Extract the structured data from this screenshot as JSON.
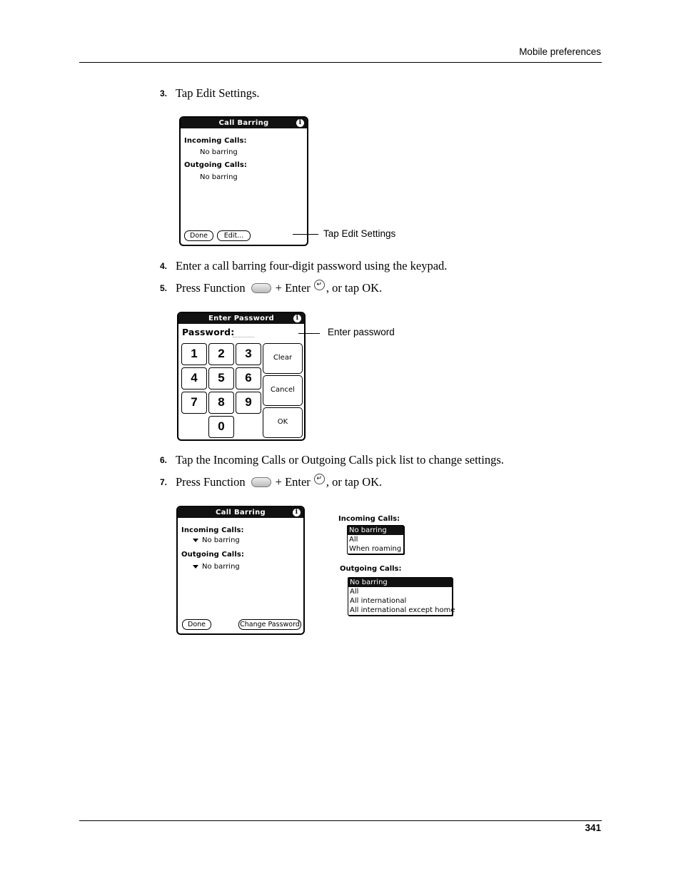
{
  "header": {
    "running_head": "Mobile preferences"
  },
  "footer": {
    "page_number": "341"
  },
  "steps": [
    {
      "num": "3.",
      "text": "Tap Edit Settings."
    },
    {
      "num": "4.",
      "text": "Enter a call barring four-digit password using the keypad."
    },
    {
      "num": "5.",
      "pre": "Press Function",
      "mid": "+ Enter",
      "post": ", or tap OK."
    },
    {
      "num": "6.",
      "text": "Tap the Incoming Calls or Outgoing Calls pick list to change settings."
    },
    {
      "num": "7.",
      "pre": "Press Function",
      "mid": "+ Enter",
      "post": ", or tap OK."
    }
  ],
  "icons": {
    "function_key": "function-key-icon",
    "enter_key": "enter-key-icon",
    "enter_glyph": "↵",
    "info_glyph": "i"
  },
  "screen1": {
    "title": "Call Barring",
    "incoming_label": "Incoming Calls:",
    "incoming_value": "No barring",
    "outgoing_label": "Outgoing Calls:",
    "outgoing_value": "No barring",
    "done_button": "Done",
    "edit_button": "Edit...",
    "callout": "Tap Edit Settings"
  },
  "screen2": {
    "title": "Enter Password",
    "password_label": "Password:",
    "password_value": "",
    "keys": [
      "1",
      "2",
      "3",
      "4",
      "5",
      "6",
      "7",
      "8",
      "9",
      "0"
    ],
    "clear_button": "Clear",
    "cancel_button": "Cancel",
    "ok_button": "OK",
    "callout": "Enter password"
  },
  "screen3": {
    "title": "Call Barring",
    "incoming_label": "Incoming Calls:",
    "incoming_value": "No barring",
    "outgoing_label": "Outgoing Calls:",
    "outgoing_value": "No barring",
    "done_button": "Done",
    "change_password_button": "Change Password"
  },
  "picklists": {
    "incoming": {
      "label": "Incoming Calls:",
      "options": [
        "No barring",
        "All",
        "When roaming"
      ],
      "selected": "No barring"
    },
    "outgoing": {
      "label": "Outgoing Calls:",
      "options": [
        "No barring",
        "All",
        "All international",
        "All international except home"
      ],
      "selected": "No barring"
    }
  }
}
